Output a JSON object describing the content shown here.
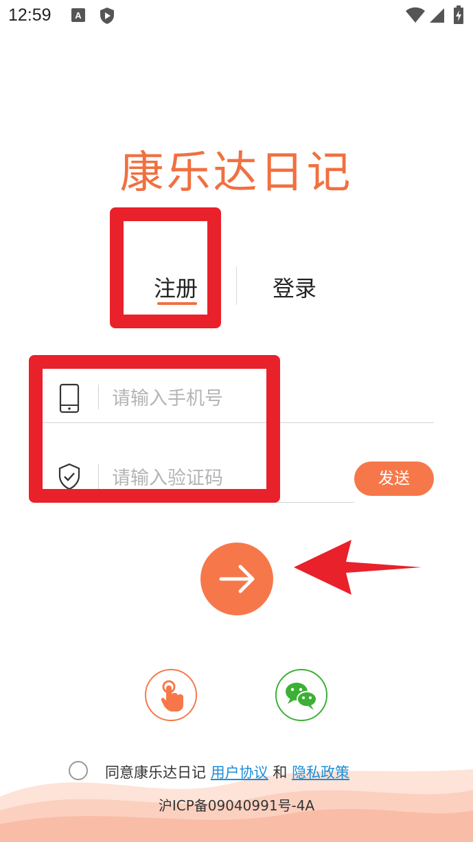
{
  "status_bar": {
    "time": "12:59",
    "icons": [
      "a-notification-icon",
      "shield-play-icon",
      "wifi-icon",
      "signal-icon",
      "battery-charging-icon"
    ]
  },
  "logo": {
    "text": "康乐达日记"
  },
  "tabs": {
    "register": "注册",
    "login": "登录"
  },
  "phone_field": {
    "placeholder": "请输入手机号",
    "value": ""
  },
  "code_field": {
    "placeholder": "请输入验证码",
    "value": ""
  },
  "send_button": {
    "label": "发送"
  },
  "alt_login": {
    "items": [
      "touch-login-icon",
      "wechat-icon"
    ]
  },
  "agreement": {
    "prefix": "同意康乐达日记",
    "user_agreement": "用户协议",
    "and": "和",
    "privacy_policy": "隐私政策"
  },
  "icp": "沪ICP备09040991号-4A",
  "colors": {
    "accent": "#f6784a",
    "annotation": "#e8212a",
    "link": "#1a8ed8",
    "wechat": "#3cb034"
  }
}
